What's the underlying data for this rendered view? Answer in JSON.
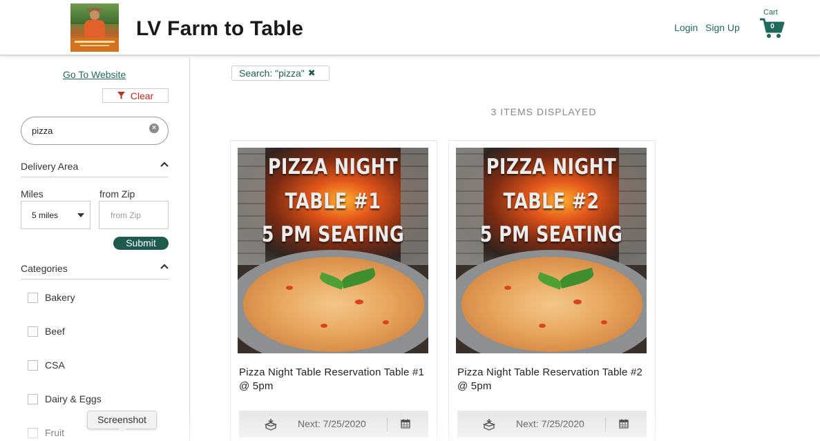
{
  "header": {
    "site_title": "LV Farm to Table",
    "login_label": "Login",
    "signup_label": "Sign Up",
    "cart_label": "Cart",
    "cart_count": "0",
    "accent_color": "#1e6b5c"
  },
  "sidebar": {
    "goto_label": "Go To Website",
    "clear_label": "Clear",
    "search_value": "pizza",
    "delivery": {
      "title": "Delivery Area",
      "miles_label": "Miles",
      "zip_label": "from Zip",
      "miles_value": "5 miles",
      "zip_placeholder": "from Zip",
      "submit_label": "Submit"
    },
    "categories": {
      "title": "Categories",
      "items": [
        {
          "label": "Bakery"
        },
        {
          "label": "Beef"
        },
        {
          "label": "CSA"
        },
        {
          "label": "Dairy & Eggs"
        },
        {
          "label": "Fruit"
        }
      ]
    }
  },
  "main": {
    "search_chip": "Search: \"pizza\"",
    "items_displayed": "3 ITEMS DISPLAYED",
    "products": [
      {
        "image_lines": [
          "PIZZA NIGHT",
          "TABLE #1",
          "5 PM SEATING"
        ],
        "name": "Pizza Night Table Reservation Table #1 @ 5pm",
        "next_date": "Next: 7/25/2020"
      },
      {
        "image_lines": [
          "PIZZA NIGHT",
          "TABLE #2",
          "5 PM SEATING"
        ],
        "name": "Pizza Night Table Reservation Table #2 @ 5pm",
        "next_date": "Next: 7/25/2020"
      }
    ]
  },
  "tooltip": {
    "label": "Screenshot"
  }
}
